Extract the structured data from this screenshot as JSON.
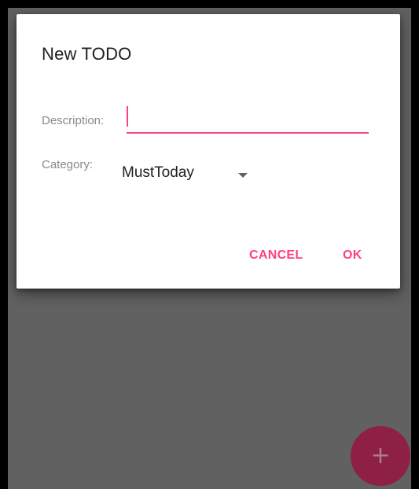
{
  "dialog": {
    "title": "New TODO",
    "description_label": "Description:",
    "description_value": "",
    "category_label": "Category:",
    "category_selected": "MustToday",
    "cancel_label": "CANCEL",
    "ok_label": "OK"
  },
  "fab": {
    "icon": "plus-icon",
    "glyph": "+"
  },
  "colors": {
    "accent": "#ff4081",
    "scrim": "#616161",
    "fab": "#8e1f45"
  }
}
